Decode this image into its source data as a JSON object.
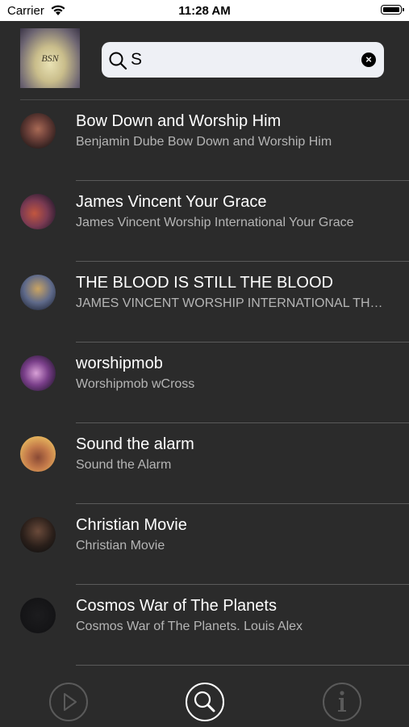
{
  "status_bar": {
    "carrier": "Carrier",
    "time": "11:28 AM"
  },
  "header": {
    "artwork_text": "BSN",
    "search": {
      "value": "S",
      "placeholder": ""
    }
  },
  "results": [
    {
      "title": "Bow Down and Worship Him",
      "subtitle": "Benjamin Dube Bow Down and Worship Him"
    },
    {
      "title": "James Vincent Your Grace",
      "subtitle": "James Vincent Worship International Your Grace"
    },
    {
      "title": "THE BLOOD IS STILL THE BLOOD",
      "subtitle": "JAMES VINCENT WORSHIP INTERNATIONAL THE BLOOD IS STILL THE BLOOD"
    },
    {
      "title": "worshipmob",
      "subtitle": "Worshipmob wCross"
    },
    {
      "title": "Sound the alarm",
      "subtitle": "Sound the Alarm"
    },
    {
      "title": "Christian Movie",
      "subtitle": "Christian Movie"
    },
    {
      "title": "Cosmos War of The Planets",
      "subtitle": "Cosmos War of The Planets. Louis Alex"
    }
  ],
  "tabbar": {
    "tabs": [
      {
        "icon": "play-icon",
        "active": false
      },
      {
        "icon": "search-icon",
        "active": true
      },
      {
        "icon": "info-icon",
        "active": false
      }
    ]
  },
  "colors": {
    "background": "#2b2b2b",
    "search_field": "#eef0f5",
    "title_text": "#ffffff",
    "subtitle_text": "#b5b5b5",
    "tab_active": "#ffffff",
    "tab_inactive": "#5a5a5a"
  }
}
